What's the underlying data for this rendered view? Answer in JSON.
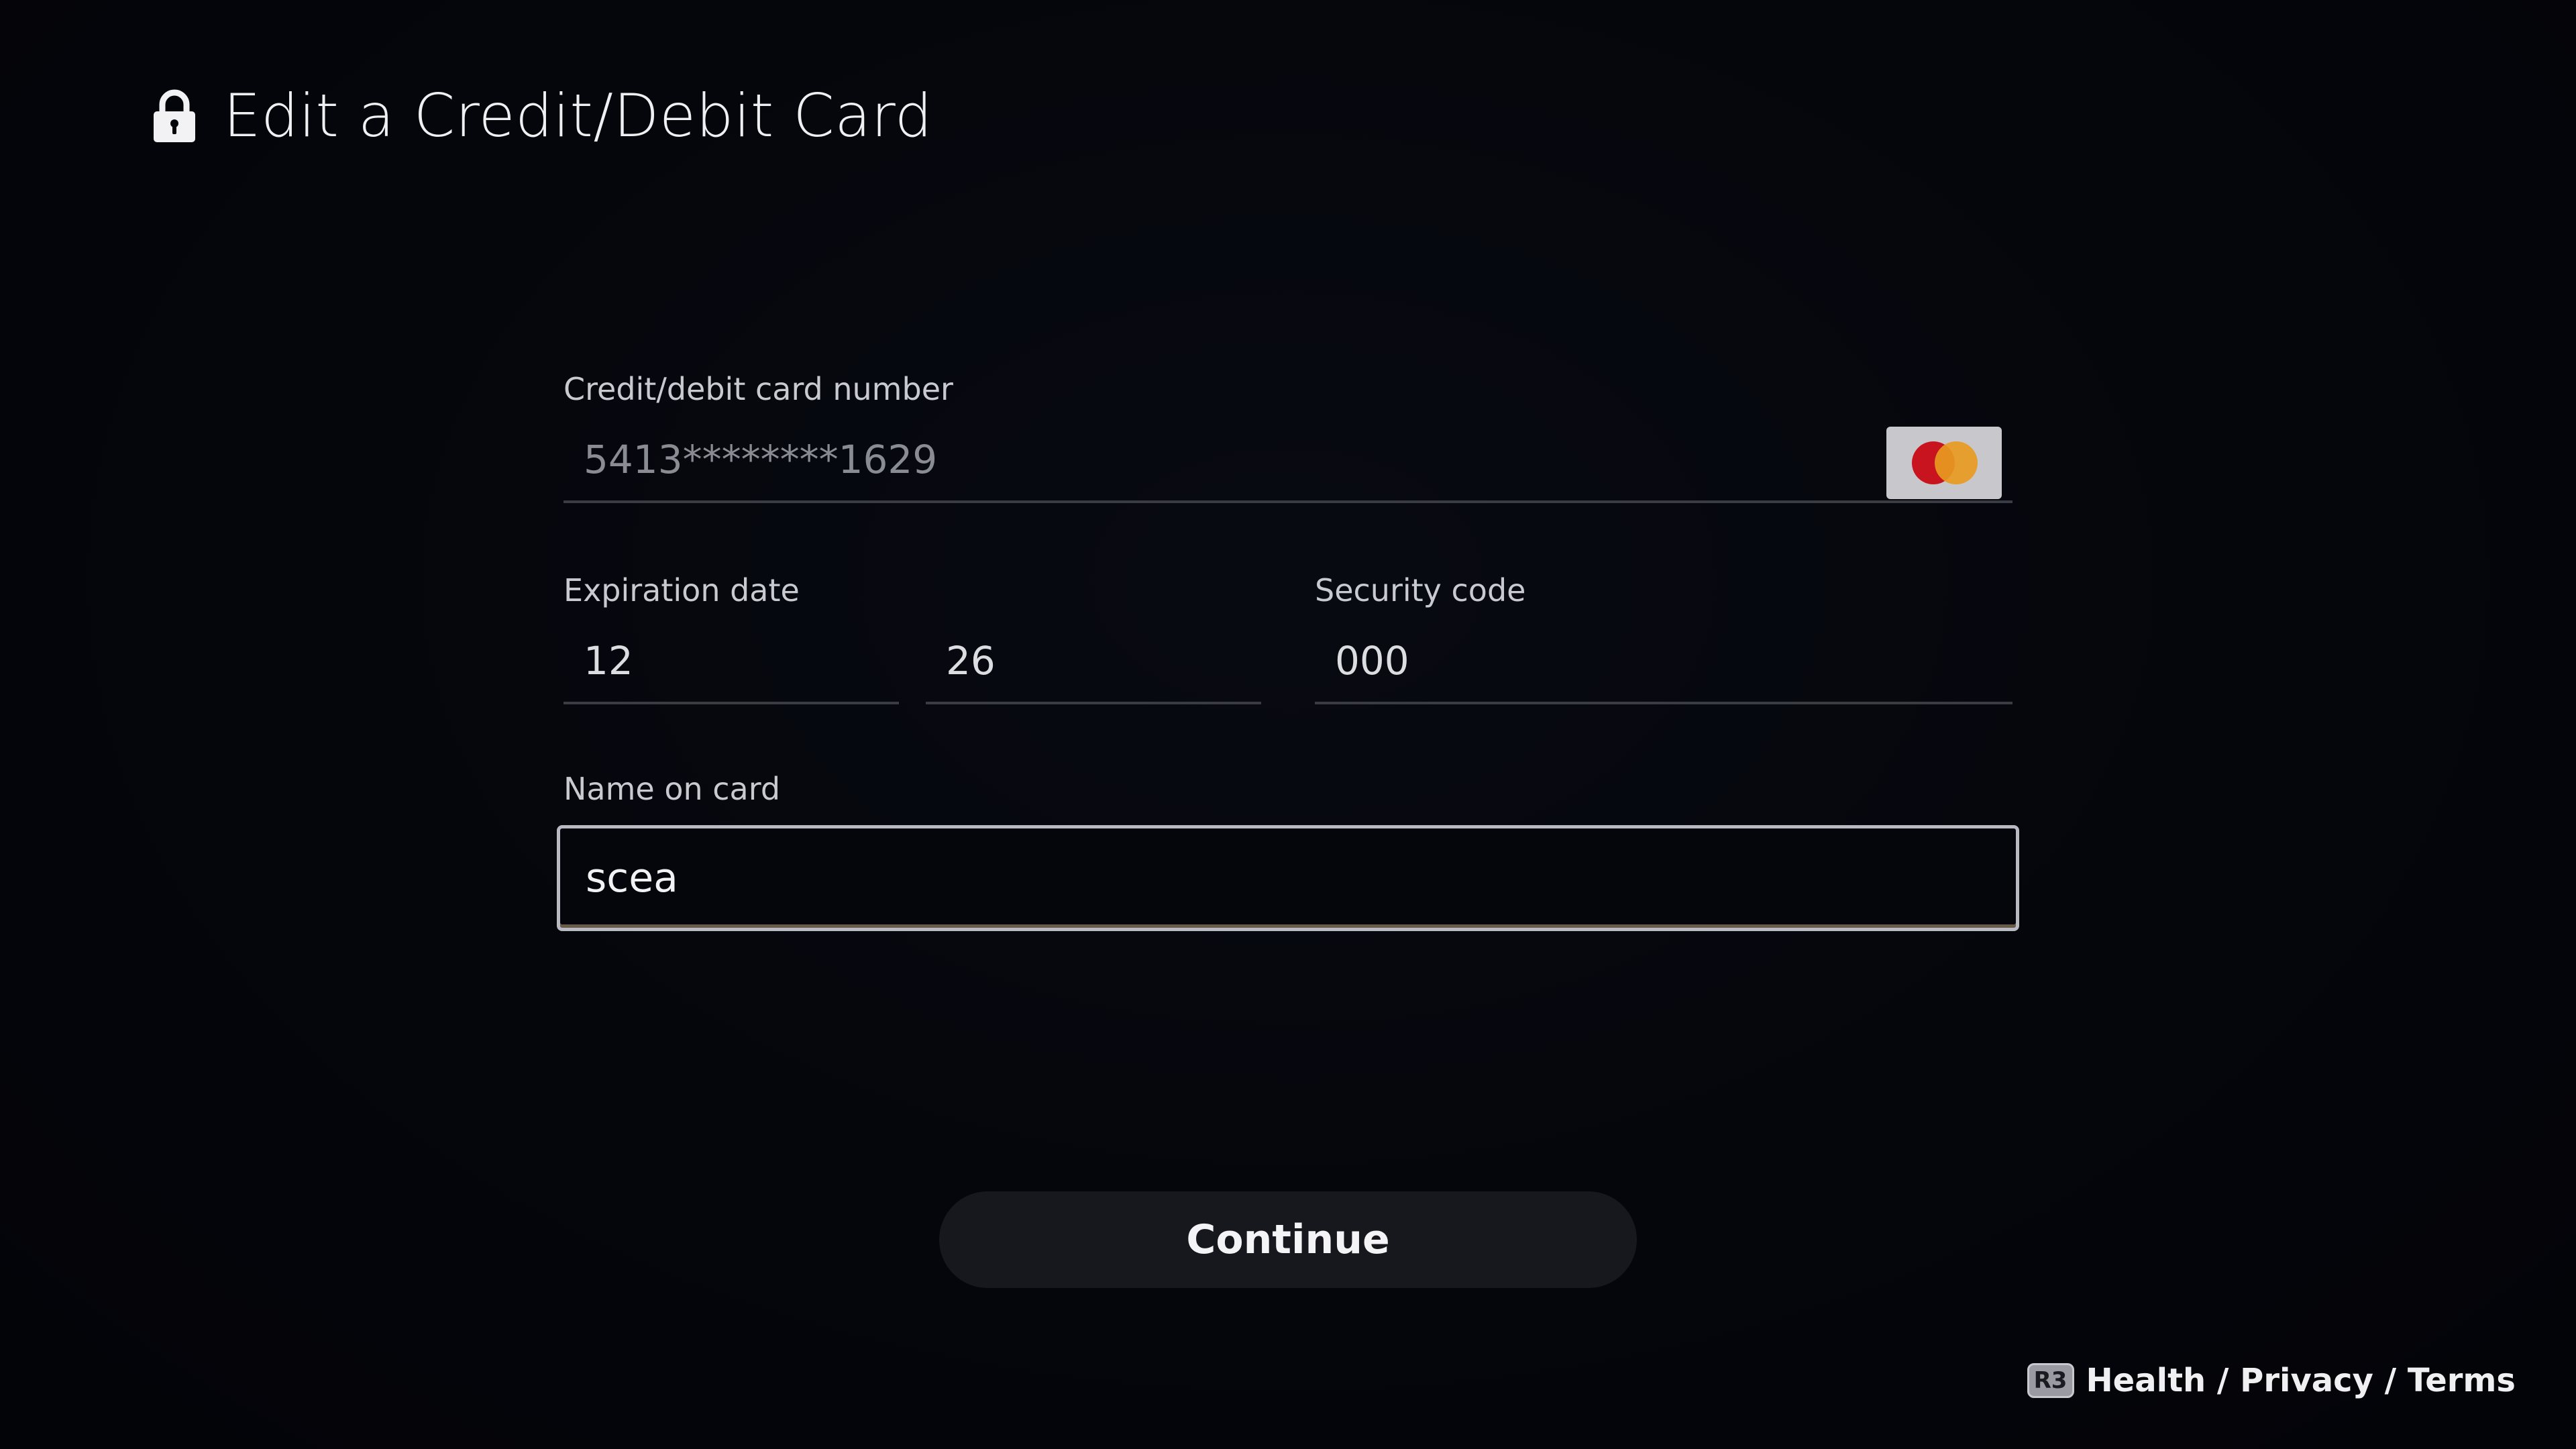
{
  "header": {
    "title": "Edit a Credit/Debit Card",
    "icon": "lock-icon"
  },
  "card_number": {
    "label": "Credit/debit card number",
    "value": "5413********1629",
    "brand_icon": "mastercard-icon",
    "brand_colors": [
      "#e0141e",
      "#f0a020"
    ]
  },
  "expiration": {
    "label": "Expiration date",
    "month": "12",
    "year": "26"
  },
  "security_code": {
    "label": "Security code",
    "value": "000"
  },
  "name_on_card": {
    "label": "Name on card",
    "value": "scea"
  },
  "continue_button": {
    "label": "Continue"
  },
  "footer": {
    "button_glyph": "R3",
    "links_text": "Health / Privacy / Terms"
  }
}
